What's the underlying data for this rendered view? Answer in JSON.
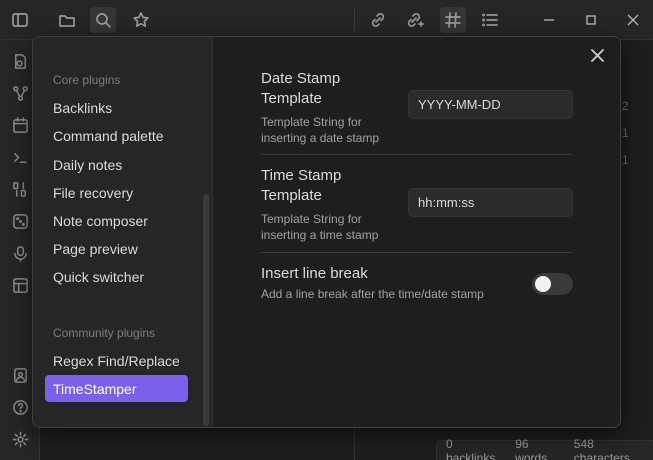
{
  "modal": {
    "sidebar": {
      "core_heading": "Core plugins",
      "core_items": [
        "Backlinks",
        "Command palette",
        "Daily notes",
        "File recovery",
        "Note composer",
        "Page preview",
        "Quick switcher"
      ],
      "community_heading": "Community plugins",
      "community_items": [
        "Regex Find/Replace",
        "TimeStamper"
      ],
      "active_item": "TimeStamper"
    },
    "settings": [
      {
        "name": "Date Stamp Template",
        "description": "Template String for inserting a date stamp",
        "value": "YYYY-MM-DD"
      },
      {
        "name": "Time Stamp Template",
        "description": "Template String for inserting a time stamp",
        "value": "hh:mm:ss"
      },
      {
        "name": "Insert line break",
        "description": "Add a line break after the time/date stamp",
        "enabled": false
      }
    ],
    "accent_color": "#7b61ea"
  },
  "background": {
    "gutter_numbers": [
      "2",
      "1",
      "1"
    ]
  },
  "statusbar": {
    "backlinks": "0 backlinks",
    "words": "96 words",
    "characters": "548 characters"
  }
}
